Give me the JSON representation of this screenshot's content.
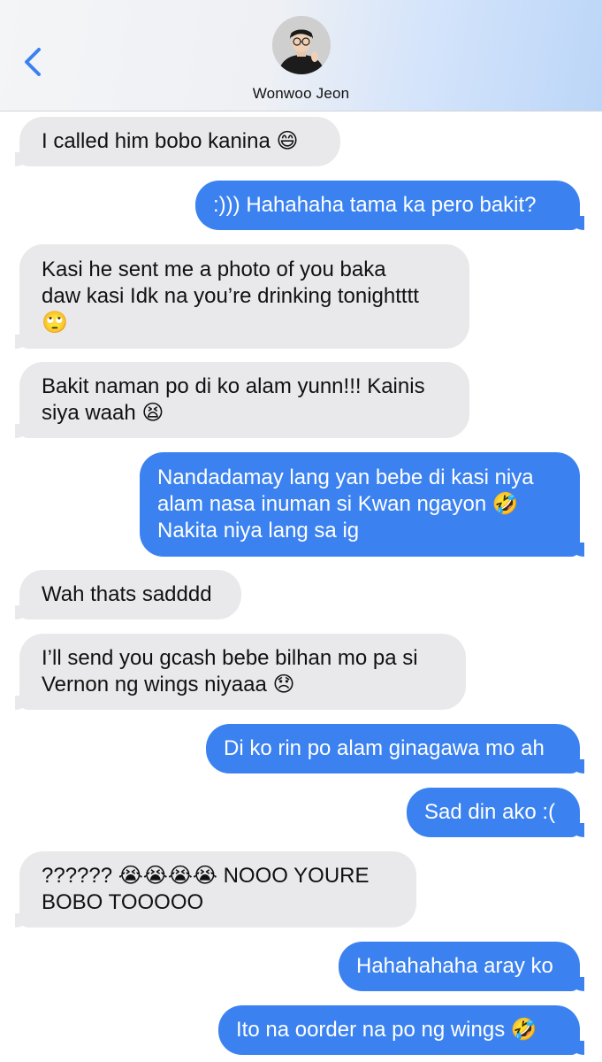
{
  "header": {
    "contact_name": "Wonwoo Jeon",
    "back_icon": "chevron-left-icon",
    "accent": "#3b82f0"
  },
  "messages": [
    {
      "direction": "in",
      "text": "I called him bobo kanina 😄"
    },
    {
      "direction": "out",
      "text": ":))) Hahahaha tama ka pero bakit?"
    },
    {
      "direction": "in",
      "text": "Kasi he sent me a photo of you baka\ndaw kasi Idk na you’re drinking tonightttt\n🙄"
    },
    {
      "direction": "in",
      "text": "Bakit naman po di ko alam yunn!!! Kainis\nsiya waah 😫"
    },
    {
      "direction": "out",
      "text": "Nandadamay lang yan bebe di kasi niya\nalam nasa inuman si Kwan ngayon 🤣\nNakita niya lang sa ig"
    },
    {
      "direction": "in",
      "text": "Wah thats sadddd"
    },
    {
      "direction": "in",
      "text": "I’ll send you gcash bebe bilhan mo pa si\nVernon ng wings niyaaa 😞"
    },
    {
      "direction": "out",
      "text": "Di ko rin po alam ginagawa mo ah"
    },
    {
      "direction": "out",
      "text": "Sad din ako :("
    },
    {
      "direction": "in",
      "text": "?????? 😭😭😭😭 NOOO YOURE\nBOBO TOOOOO"
    },
    {
      "direction": "out",
      "text": "Hahahahaha aray ko"
    },
    {
      "direction": "out",
      "text": "Ito na oorder na po ng wings 🤣"
    }
  ]
}
